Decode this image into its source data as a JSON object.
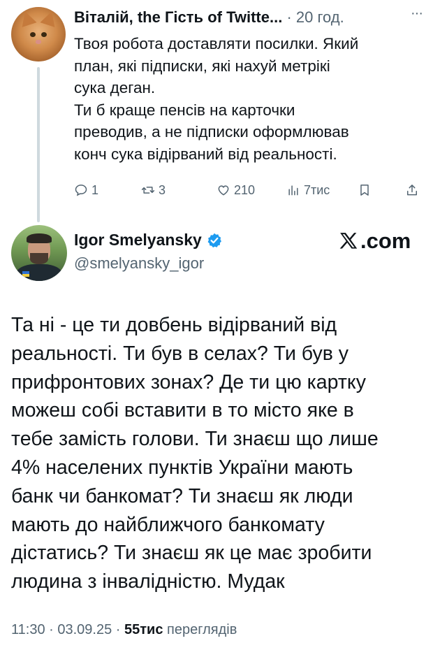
{
  "reply": {
    "author_name": "Віталій, the Гість of Twitte...",
    "separator": " · ",
    "time": "20 год.",
    "more": "···",
    "text_lines": [
      "Твоя робота доставляти посилки. Який",
      "план, які підписки, які нахуй метрікі",
      "сука деган.",
      "Ти б краще пенсів на карточки",
      "преводив, а не підписки оформлював",
      "конч сука відірваний від реальності."
    ],
    "actions": {
      "replies": "1",
      "reposts": "3",
      "likes": "210",
      "views": "7тис"
    }
  },
  "tweet": {
    "author_name": "Igor Smelyansky",
    "handle": "@smelyansky_igor",
    "site_badge": ".com",
    "text_lines": [
      "Та ні - це ти довбень відірваний від",
      "реальності. Ти був в селах? Ти був у",
      "прифронтових зонах? Де ти цю картку",
      "можеш собі вставити в то місто яке в",
      "тебе замість голови. Ти знаєш що лише",
      "4% населених пунктів України мають",
      "банк чи банкомат? Ти знаєш як люди",
      "мають до найближчого банкомату",
      "дістатись? Ти знаєш як це має зробити",
      "людина з інвалідністю. Мудак"
    ],
    "time": "11:30",
    "date": "03.09.25",
    "views_count": "55тис",
    "views_label": "переглядів"
  },
  "colors": {
    "text": "#0f1419",
    "secondary": "#536471",
    "verified_blue": "#1d9bf0",
    "thread_line": "#cfd9de"
  },
  "icons": {
    "reply": "comment-icon",
    "repost": "repost-icon",
    "like": "heart-icon",
    "views": "analytics-icon",
    "bookmark": "bookmark-icon",
    "share": "share-icon",
    "verified": "verified-badge-icon",
    "x_logo": "x-logo-icon"
  }
}
